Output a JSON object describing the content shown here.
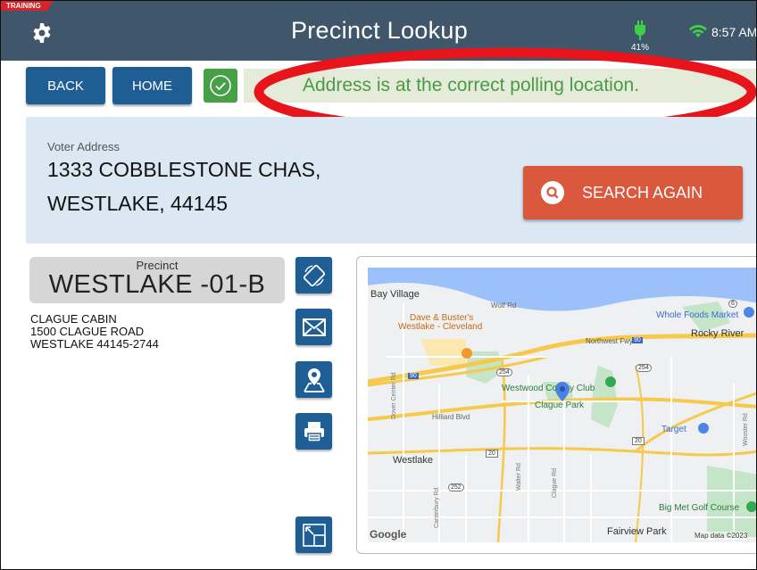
{
  "header": {
    "training_badge": "TRAINING",
    "title": "Precinct Lookup",
    "battery_percent": "41%",
    "time": "8:57 AM"
  },
  "toolbar": {
    "back_label": "BACK",
    "home_label": "HOME",
    "status_message": "Address is at the correct polling location."
  },
  "voter": {
    "label": "Voter Address",
    "line1": "1333 COBBLESTONE CHAS,",
    "line2": "WESTLAKE, 44145",
    "search_again_label": "SEARCH AGAIN"
  },
  "precinct": {
    "label": "Precinct",
    "name": "WESTLAKE -01-B"
  },
  "polling_location": {
    "name": "CLAGUE CABIN",
    "street": "1500 CLAGUE ROAD",
    "city_zip": "WESTLAKE 44145-2744"
  },
  "map": {
    "labels": {
      "bay_village": "Bay Village",
      "wolf_rd": "Wolf Rd",
      "dave_busters_1": "Dave & Buster's",
      "dave_busters_2": "Westlake - Cleveland",
      "whole_foods": "Whole Foods Market",
      "rocky_river": "Rocky River",
      "northwest_fwy": "Northwest Fwy",
      "westwood": "Westwood Co",
      "westwood_2": "y Club",
      "clague_park": "Clague Park",
      "hilliard": "Hilliard Blvd",
      "target": "Target",
      "westlake": "Westlake",
      "big_met": "Big Met Golf Course",
      "fairview": "Fairview Park",
      "google": "Google",
      "map_data": "Map data ©2023",
      "dover": "Dover Center Rd",
      "walter": "Walter Rd",
      "clague_rd": "Clague Rd",
      "canterbury": "Canterbury Rd",
      "wooster": "Wooster Rd",
      "shield_254a": "254",
      "shield_254b": "254",
      "shield_252": "252",
      "shield_20a": "20",
      "shield_20b": "20",
      "shield_90a": "90",
      "shield_90b": "90",
      "shield_6": "6"
    }
  },
  "colors": {
    "header_bg": "#40566b",
    "button_blue": "#1f5e95",
    "success_green": "#46a046",
    "status_bg": "#e4ecd9",
    "address_bg": "#dbe8f4",
    "search_red": "#d9583e",
    "highlight_ring": "#e8141c"
  }
}
